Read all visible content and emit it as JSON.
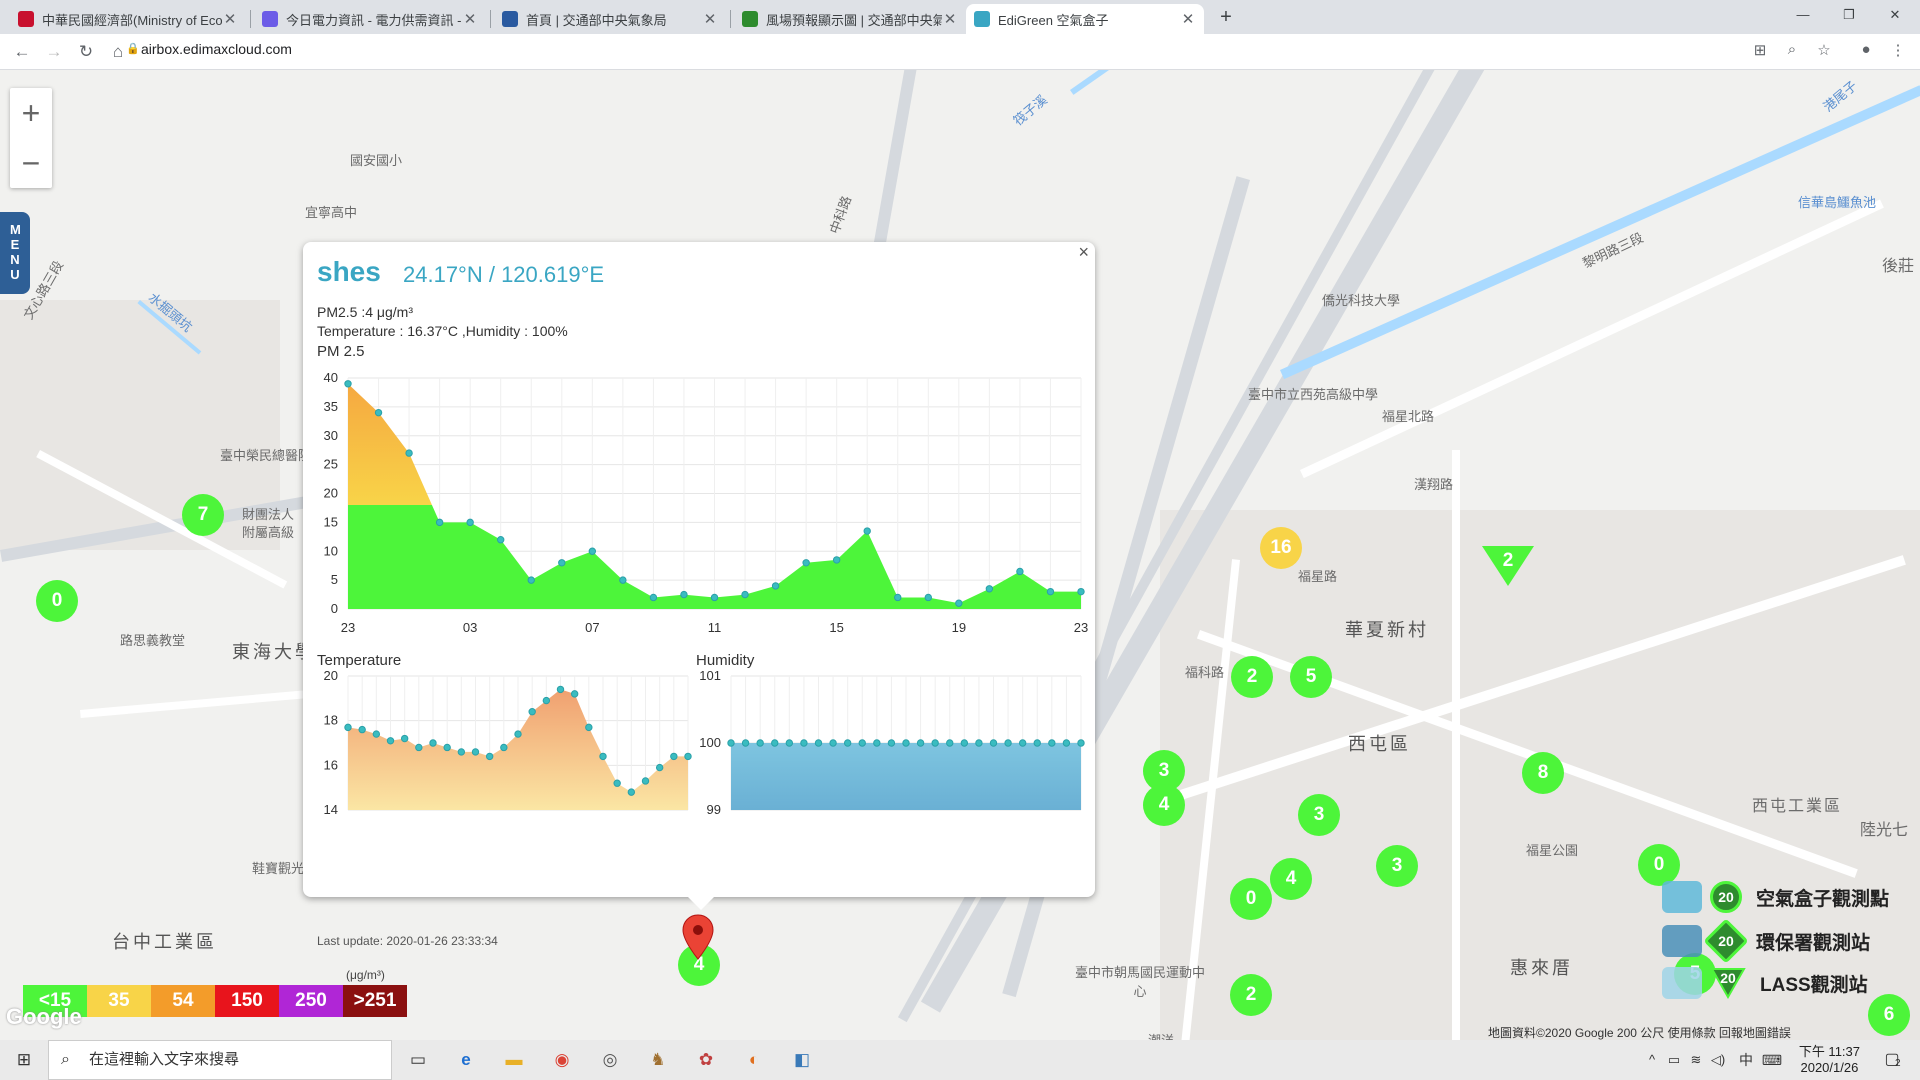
{
  "browser": {
    "tabs": [
      {
        "title": "中華民國經濟部(Ministry of Econ",
        "fav_color": "#c8102e"
      },
      {
        "title": "今日電力資訊 - 電力供需資訊 - 台",
        "fav_color": "#6c5ce7"
      },
      {
        "title": "首頁 | 交通部中央氣象局",
        "fav_color": "#2a5aa0"
      },
      {
        "title": "風場預報顯示圖 | 交通部中央氣象",
        "fav_color": "#2e8b2e"
      },
      {
        "title": "EdiGreen 空氣盒子",
        "fav_color": "#3aa6c3"
      }
    ],
    "url": "airbox.edimaxcloud.com"
  },
  "map": {
    "labels": [
      "國安國小",
      "宜寧高中",
      "臺中榮民總醫院",
      "財團法人",
      "附屬高級",
      "路思義教堂",
      "東海大學",
      "台中工業區",
      "鞋寶觀光工廠",
      "華夏新村",
      "西屯區",
      "福科路",
      "福星路",
      "漢翔路",
      "黎明路三段",
      "福星北路",
      "臺中市立西苑高級中學",
      "僑光科技大學",
      "臺中市朝馬國民運動中心",
      "惠來厝",
      "潮洋",
      "西屯工業區",
      "福星公園",
      "陸光七",
      "信華島鱷魚池",
      "後莊",
      "港尾子",
      "筏子溪",
      "水掘頭坑",
      "中科路",
      "文心路三段"
    ],
    "clusters": [
      {
        "v": "7"
      },
      {
        "v": "0"
      },
      {
        "v": "16"
      },
      {
        "v": "2"
      },
      {
        "v": "5"
      },
      {
        "v": "3"
      },
      {
        "v": "4"
      },
      {
        "v": "3"
      },
      {
        "v": "3"
      },
      {
        "v": "4"
      },
      {
        "v": "0"
      },
      {
        "v": "8"
      },
      {
        "v": "0"
      },
      {
        "v": "5"
      },
      {
        "v": "2"
      },
      {
        "v": "4"
      },
      {
        "v": "6"
      }
    ],
    "triangle_value": "2",
    "menu_label": "MENU",
    "attribution": "地圖資料©2020 Google   200 公尺         使用條款   回報地圖錯誤",
    "google_logo": "Google"
  },
  "popup": {
    "station": "shes",
    "coords": "24.17°N / 120.619°E",
    "pm_line": "PM2.5 :4 μg/m³",
    "temp_line": "Temperature : 16.37°C ,Humidity : 100%",
    "pm_title": "PM 2.5",
    "temp_title": "Temperature",
    "hum_title": "Humidity",
    "last_update": "Last update: 2020-01-26 23:33:34",
    "close": "×"
  },
  "chart_data": [
    {
      "type": "area",
      "title": "PM 2.5",
      "x_ticks": [
        "23",
        "03",
        "07",
        "11",
        "15",
        "19",
        "23"
      ],
      "ylim": [
        0,
        40
      ],
      "y_ticks": [
        0,
        5,
        10,
        15,
        20,
        25,
        30,
        35,
        40
      ],
      "values": [
        39,
        34,
        27,
        15,
        15,
        12,
        5,
        8,
        10,
        5,
        2,
        2.5,
        2,
        2.5,
        4,
        8,
        8.5,
        13.5,
        2,
        2,
        1,
        3.5,
        6.5,
        3,
        3
      ],
      "grid": true
    },
    {
      "type": "area",
      "title": "Temperature",
      "ylim": [
        14,
        20
      ],
      "y_ticks": [
        14,
        16,
        18,
        20
      ],
      "values": [
        17.7,
        17.6,
        17.4,
        17.1,
        17.2,
        16.8,
        17.0,
        16.8,
        16.6,
        16.6,
        16.4,
        16.8,
        17.4,
        18.4,
        18.9,
        19.4,
        19.2,
        17.7,
        16.4,
        15.2,
        14.8,
        15.3,
        15.9,
        16.4,
        16.4
      ],
      "grid": true
    },
    {
      "type": "area",
      "title": "Humidity",
      "ylim": [
        99,
        101
      ],
      "y_ticks": [
        99,
        100,
        101
      ],
      "values": [
        100,
        100,
        100,
        100,
        100,
        100,
        100,
        100,
        100,
        100,
        100,
        100,
        100,
        100,
        100,
        100,
        100,
        100,
        100,
        100,
        100,
        100,
        100,
        100,
        100
      ],
      "grid": true
    }
  ],
  "legend": {
    "bins": [
      {
        "label": "<15",
        "color": "#4df53a"
      },
      {
        "label": "35",
        "color": "#f8d448"
      },
      {
        "label": "54",
        "color": "#f39c2a"
      },
      {
        "label": "150",
        "color": "#e8141c"
      },
      {
        "label": "250",
        "color": "#b026d6"
      },
      {
        "label": ">251",
        "color": "#8b1010"
      }
    ],
    "unit": "(μg/m³)",
    "types": [
      {
        "label": "空氣盒子觀測點",
        "num": "20"
      },
      {
        "label": "環保署觀測站",
        "num": "20"
      },
      {
        "label": "LASS觀測站",
        "num": "20"
      }
    ]
  },
  "taskbar": {
    "search_placeholder": "在這裡輸入文字來搜尋",
    "ime": "中",
    "time": "下午 11:37",
    "date": "2020/1/26",
    "notif_count": "2"
  }
}
